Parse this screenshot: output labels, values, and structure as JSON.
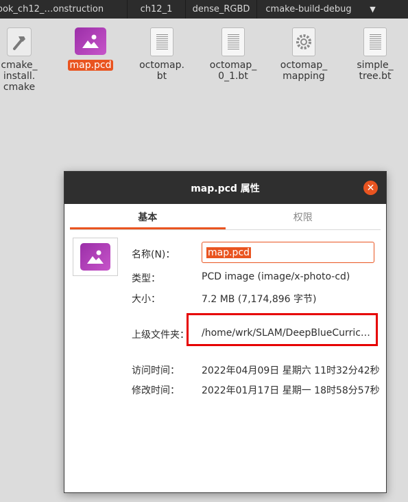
{
  "tabs": [
    "ook_ch12_…onstruction",
    "ch12_1",
    "dense_RGBD",
    "cmake-build-debug"
  ],
  "files": [
    {
      "name": "cmake_\ninstall.\ncmake",
      "icon": "hammer-icon"
    },
    {
      "name": "map.pcd",
      "icon": "image-icon",
      "selected": true
    },
    {
      "name": "octomap.\nbt",
      "icon": "document-icon"
    },
    {
      "name": "octomap_\n0_1.bt",
      "icon": "document-icon"
    },
    {
      "name": "octomap_\nmapping",
      "icon": "gear-icon"
    },
    {
      "name": "simple_\ntree.bt",
      "icon": "document-icon"
    }
  ],
  "dialog": {
    "title": "map.pcd 属性",
    "close": "✕",
    "tabs": {
      "basic": "基本",
      "permissions": "权限"
    },
    "labels": {
      "name": "名称(N)：",
      "type": "类型：",
      "size": "大小：",
      "parent": "上级文件夹：",
      "accessed": "访问时间：",
      "modified": "修改时间："
    },
    "values": {
      "name": "map.pcd",
      "type": "PCD image (image/x-photo-cd)",
      "size": "7.2 MB (7,174,896 字节)",
      "parent": "/home/wrk/SLAM/DeepBlueCurricu…",
      "accessed": "2022年04月09日 星期六 11时32分42秒",
      "modified": "2022年01月17日 星期一 18时58分57秒"
    }
  },
  "colors": {
    "accent": "#e95420",
    "highlight_box": "#e60000",
    "titlebar": "#2f2f2f"
  }
}
